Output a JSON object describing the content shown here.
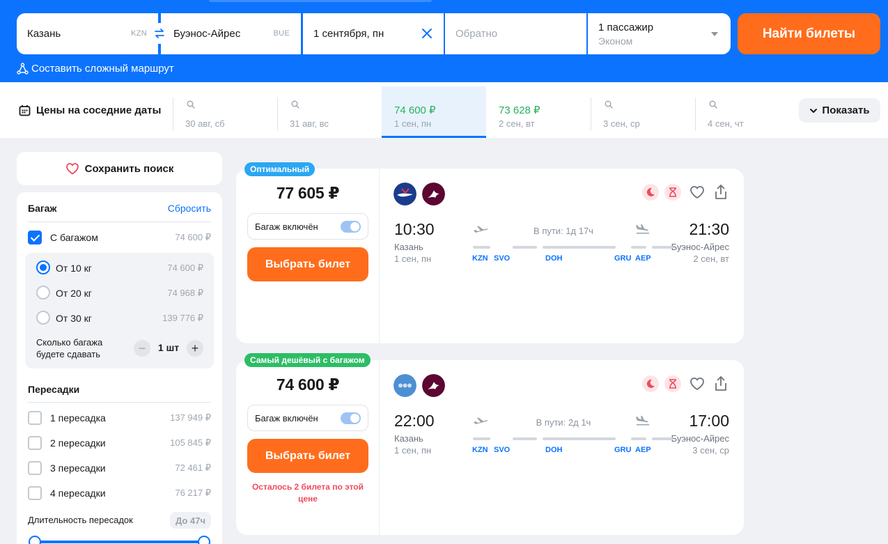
{
  "search": {
    "from_city": "Казань",
    "from_code": "KZN",
    "to_city": "Буэнос-Айрес",
    "to_code": "BUE",
    "date": "1 сентября, пн",
    "return_placeholder": "Обратно",
    "passengers": "1 пассажир",
    "cabin": "Эконом",
    "find_label": "Найти билеты",
    "complex_route": "Составить сложный маршрут"
  },
  "nearby": {
    "title": "Цены на соседние даты",
    "cells": [
      {
        "price": "",
        "date": "30 авг, сб"
      },
      {
        "price": "",
        "date": "31 авг, вс"
      },
      {
        "price": "74 600 ₽",
        "date": "1 сен, пн",
        "active": true
      },
      {
        "price": "73 628 ₽",
        "date": "2 сен, вт"
      },
      {
        "price": "",
        "date": "3 сен, ср"
      },
      {
        "price": "",
        "date": "4 сен, чт"
      }
    ],
    "show_label": "Показать"
  },
  "sidebar": {
    "save_search": "Сохранить поиск",
    "baggage": {
      "title": "Багаж",
      "reset": "Сбросить",
      "with_baggage": {
        "label": "С багажом",
        "price": "74 600 ₽",
        "checked": true
      },
      "weights": [
        {
          "label": "От 10 кг",
          "price": "74 600 ₽",
          "selected": true
        },
        {
          "label": "От 20 кг",
          "price": "74 968 ₽",
          "selected": false
        },
        {
          "label": "От 30 кг",
          "price": "139 776 ₽",
          "selected": false
        }
      ],
      "count_label": "Сколько багажа будете сдавать",
      "count_value": "1 шт"
    },
    "transfers": {
      "title": "Пересадки",
      "items": [
        {
          "label": "1 пересадка",
          "price": "137 949 ₽"
        },
        {
          "label": "2 пересадки",
          "price": "105 845 ₽"
        },
        {
          "label": "3 пересадки",
          "price": "72 461 ₽"
        },
        {
          "label": "4 пересадки",
          "price": "76 217 ₽"
        }
      ],
      "duration_label": "Длительность пересадок",
      "duration_badge": "До 47ч"
    }
  },
  "tickets": [
    {
      "badge": "Оптимальный",
      "badge_color": "#2ba7f2",
      "price": "77 605 ₽",
      "bag_label": "Багаж включён",
      "button": "Выбрать билет",
      "note": "",
      "dep_time": "10:30",
      "dep_city": "Казань",
      "dep_date": "1 сен, пн",
      "arr_time": "21:30",
      "arr_city": "Буэнос-Айрес",
      "arr_date": "2 сен, вт",
      "duration": "В пути: 1д 17ч",
      "stops": [
        "KZN",
        "SVO",
        "DOH",
        "GRU",
        "AEP"
      ]
    },
    {
      "badge": "Самый дешёвый с багажом",
      "badge_color": "#2dbd66",
      "price": "74 600 ₽",
      "bag_label": "Багаж включён",
      "button": "Выбрать билет",
      "note": "Осталось 2 билета по этой цене",
      "dep_time": "22:00",
      "dep_city": "Казань",
      "dep_date": "1 сен, пн",
      "arr_time": "17:00",
      "arr_city": "Буэнос-Айрес",
      "arr_date": "3 сен, ср",
      "duration": "В пути: 2д 1ч",
      "stops": [
        "KZN",
        "SVO",
        "DOH",
        "GRU",
        "AEP"
      ]
    }
  ],
  "colors": {
    "brand": "#0c73fe",
    "accent": "#ff6d1c",
    "price_green": "#2ab15a",
    "warn": "#ef4a5b"
  }
}
